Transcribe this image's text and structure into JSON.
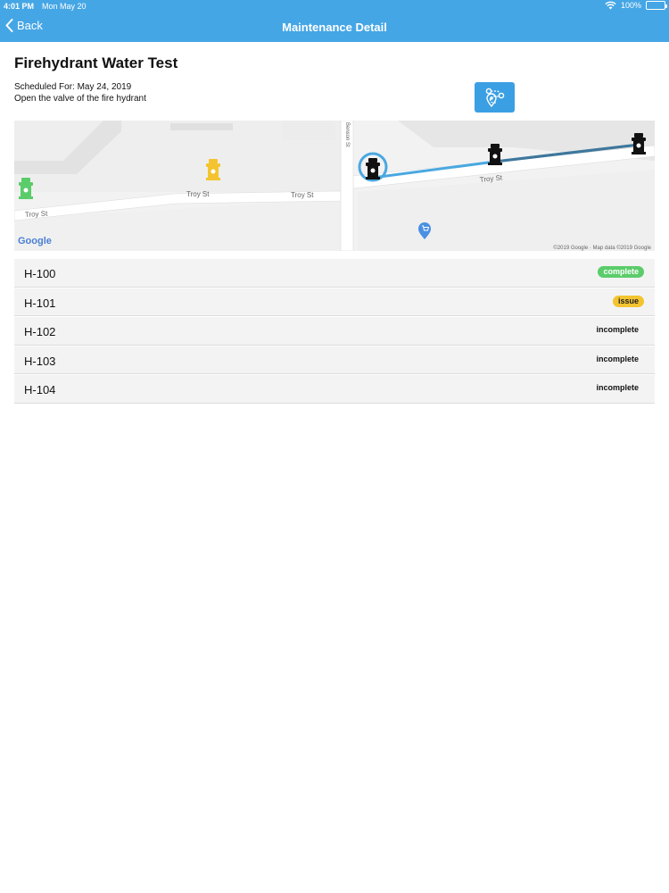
{
  "status_bar": {
    "time": "4:01 PM",
    "date": "Mon May 20",
    "battery": "100%"
  },
  "nav": {
    "back_label": "Back",
    "title": "Maintenance Detail"
  },
  "header": {
    "title": "Firehydrant Water Test",
    "scheduled": "Scheduled For: May 24, 2019",
    "description": "Open the valve of the fire hydrant"
  },
  "route_button": {
    "icon": "route-icon"
  },
  "map": {
    "street_labels": [
      "Troy St",
      "Troy St",
      "Troy St",
      "Troy St",
      "Benson St"
    ],
    "provider": "Google",
    "attribution": "©2019 Google · Map data ©2019 Google",
    "hydrant_colors": {
      "complete": "#5bcc6a",
      "issue": "#f4c430",
      "incomplete": "#111111"
    },
    "route_color": "#4aa8e0"
  },
  "hydrants": [
    {
      "id": "H-100",
      "status": "complete"
    },
    {
      "id": "H-101",
      "status": "issue"
    },
    {
      "id": "H-102",
      "status": "incomplete"
    },
    {
      "id": "H-103",
      "status": "incomplete"
    },
    {
      "id": "H-104",
      "status": "incomplete"
    }
  ]
}
